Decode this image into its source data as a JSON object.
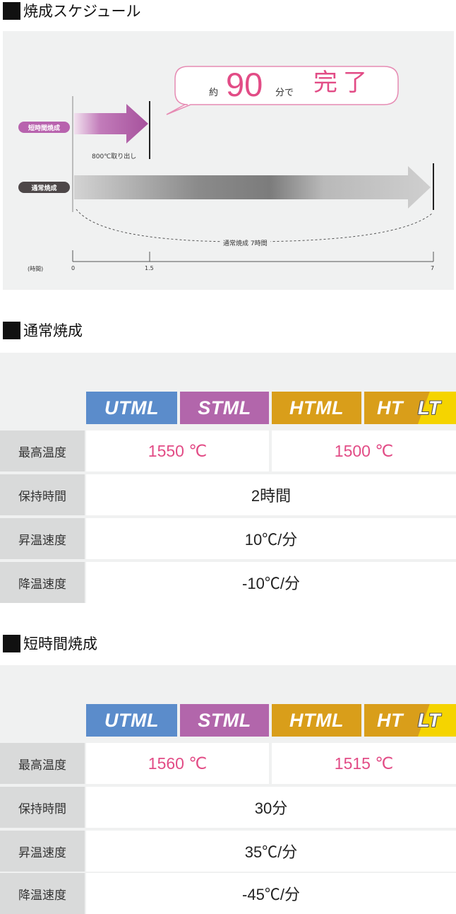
{
  "schedule": {
    "title": "焼成スケジュール",
    "short_label": "短時間焼成",
    "normal_label": "通常焼成",
    "remove_note": "800℃取り出し",
    "bubble": {
      "prefix": "約",
      "number": "90",
      "suffix": "分で",
      "done": "完了"
    },
    "normal_duration": "通常焼成 7時間",
    "axis_unit": "(時間)",
    "axis_ticks": [
      "0",
      "1.5",
      "7"
    ],
    "colors": {
      "accent": "#e24c86",
      "short_pill": "#b863ae",
      "normal_pill": "#4d4748"
    }
  },
  "headers": {
    "utml": "UTML",
    "stml": "STML",
    "html": "HTML",
    "ht": "HT",
    "lt": "LT"
  },
  "normal": {
    "title": "通常焼成",
    "rows": [
      {
        "label": "最高温度",
        "values": [
          "1550 ℃",
          "1500 ℃"
        ]
      },
      {
        "label": "保持時間",
        "value": "2時間"
      },
      {
        "label": "昇温速度",
        "value": "10℃/分"
      },
      {
        "label": "降温速度",
        "value": "-10℃/分"
      }
    ]
  },
  "short": {
    "title": "短時間焼成",
    "rows": [
      {
        "label": "最高温度",
        "values": [
          "1560 ℃",
          "1515 ℃"
        ]
      },
      {
        "label": "保持時間",
        "value": "30分"
      },
      {
        "label": "昇温速度",
        "value": "35℃/分"
      },
      {
        "label": "降温速度",
        "value": "-45℃/分"
      }
    ]
  }
}
